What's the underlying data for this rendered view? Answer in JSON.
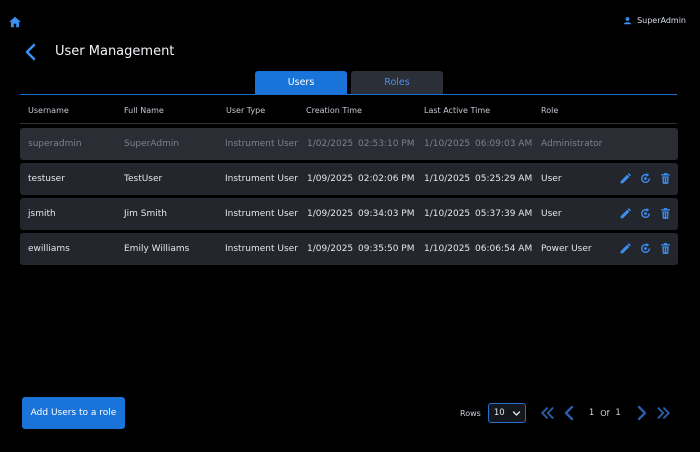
{
  "header": {
    "user_name": "SuperAdmin",
    "page_title": "User Management"
  },
  "tabs": [
    {
      "label": "Users",
      "active": true
    },
    {
      "label": "Roles",
      "active": false
    }
  ],
  "table": {
    "columns": [
      "Username",
      "Full Name",
      "User Type",
      "Creation Time",
      "Last Active Time",
      "Role"
    ],
    "rows": [
      {
        "username": "superadmin",
        "full_name": "SuperAdmin",
        "user_type": "Instrument User",
        "created_date": "1/02/2025",
        "created_time": "02:53:10 PM",
        "active_date": "1/10/2025",
        "active_time": "06:09:03 AM",
        "role": "Administrator",
        "disabled": true
      },
      {
        "username": "testuser",
        "full_name": "TestUser",
        "user_type": "Instrument User",
        "created_date": "1/09/2025",
        "created_time": "02:02:06 PM",
        "active_date": "1/10/2025",
        "active_time": "05:25:29 AM",
        "role": "User",
        "disabled": false
      },
      {
        "username": "jsmith",
        "full_name": "Jim Smith",
        "user_type": "Instrument User",
        "created_date": "1/09/2025",
        "created_time": "09:34:03 PM",
        "active_date": "1/10/2025",
        "active_time": "05:37:39 AM",
        "role": "User",
        "disabled": false
      },
      {
        "username": "ewilliams",
        "full_name": "Emily Williams",
        "user_type": "Instrument User",
        "created_date": "1/09/2025",
        "created_time": "09:35:50 PM",
        "active_date": "1/10/2025",
        "active_time": "06:06:54 AM",
        "role": "Power User",
        "disabled": false
      }
    ]
  },
  "footer": {
    "add_button_label": "Add Users to a role",
    "rows_label": "Rows",
    "rows_value": "10",
    "current_page": "1",
    "of_label": "Of",
    "total_pages": "1"
  },
  "icons": {
    "home": "home-icon",
    "user": "user-icon",
    "back": "chevron-left-icon",
    "edit": "pencil-icon",
    "reset": "reset-icon",
    "delete": "trash-icon"
  },
  "colors": {
    "accent": "#1a73d8",
    "accent_icon": "#3d8ef0",
    "background": "#000000",
    "row_background": "#23262d"
  }
}
